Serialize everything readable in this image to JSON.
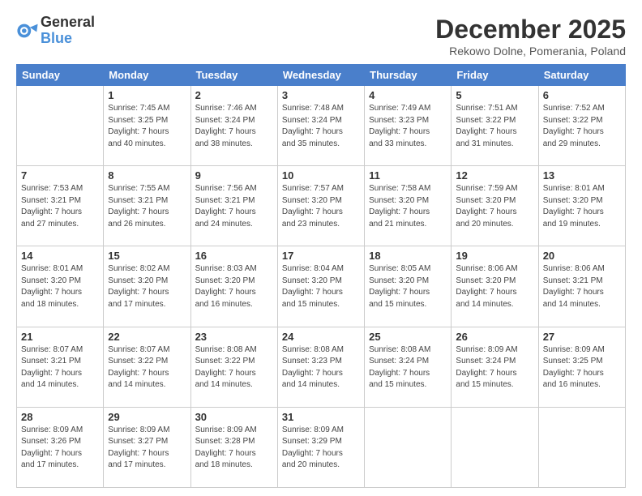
{
  "logo": {
    "general": "General",
    "blue": "Blue"
  },
  "header": {
    "month": "December 2025",
    "location": "Rekowo Dolne, Pomerania, Poland"
  },
  "weekdays": [
    "Sunday",
    "Monday",
    "Tuesday",
    "Wednesday",
    "Thursday",
    "Friday",
    "Saturday"
  ],
  "weeks": [
    [
      {
        "day": "",
        "info": ""
      },
      {
        "day": "1",
        "info": "Sunrise: 7:45 AM\nSunset: 3:25 PM\nDaylight: 7 hours\nand 40 minutes."
      },
      {
        "day": "2",
        "info": "Sunrise: 7:46 AM\nSunset: 3:24 PM\nDaylight: 7 hours\nand 38 minutes."
      },
      {
        "day": "3",
        "info": "Sunrise: 7:48 AM\nSunset: 3:24 PM\nDaylight: 7 hours\nand 35 minutes."
      },
      {
        "day": "4",
        "info": "Sunrise: 7:49 AM\nSunset: 3:23 PM\nDaylight: 7 hours\nand 33 minutes."
      },
      {
        "day": "5",
        "info": "Sunrise: 7:51 AM\nSunset: 3:22 PM\nDaylight: 7 hours\nand 31 minutes."
      },
      {
        "day": "6",
        "info": "Sunrise: 7:52 AM\nSunset: 3:22 PM\nDaylight: 7 hours\nand 29 minutes."
      }
    ],
    [
      {
        "day": "7",
        "info": "Sunrise: 7:53 AM\nSunset: 3:21 PM\nDaylight: 7 hours\nand 27 minutes."
      },
      {
        "day": "8",
        "info": "Sunrise: 7:55 AM\nSunset: 3:21 PM\nDaylight: 7 hours\nand 26 minutes."
      },
      {
        "day": "9",
        "info": "Sunrise: 7:56 AM\nSunset: 3:21 PM\nDaylight: 7 hours\nand 24 minutes."
      },
      {
        "day": "10",
        "info": "Sunrise: 7:57 AM\nSunset: 3:20 PM\nDaylight: 7 hours\nand 23 minutes."
      },
      {
        "day": "11",
        "info": "Sunrise: 7:58 AM\nSunset: 3:20 PM\nDaylight: 7 hours\nand 21 minutes."
      },
      {
        "day": "12",
        "info": "Sunrise: 7:59 AM\nSunset: 3:20 PM\nDaylight: 7 hours\nand 20 minutes."
      },
      {
        "day": "13",
        "info": "Sunrise: 8:01 AM\nSunset: 3:20 PM\nDaylight: 7 hours\nand 19 minutes."
      }
    ],
    [
      {
        "day": "14",
        "info": "Sunrise: 8:01 AM\nSunset: 3:20 PM\nDaylight: 7 hours\nand 18 minutes."
      },
      {
        "day": "15",
        "info": "Sunrise: 8:02 AM\nSunset: 3:20 PM\nDaylight: 7 hours\nand 17 minutes."
      },
      {
        "day": "16",
        "info": "Sunrise: 8:03 AM\nSunset: 3:20 PM\nDaylight: 7 hours\nand 16 minutes."
      },
      {
        "day": "17",
        "info": "Sunrise: 8:04 AM\nSunset: 3:20 PM\nDaylight: 7 hours\nand 15 minutes."
      },
      {
        "day": "18",
        "info": "Sunrise: 8:05 AM\nSunset: 3:20 PM\nDaylight: 7 hours\nand 15 minutes."
      },
      {
        "day": "19",
        "info": "Sunrise: 8:06 AM\nSunset: 3:20 PM\nDaylight: 7 hours\nand 14 minutes."
      },
      {
        "day": "20",
        "info": "Sunrise: 8:06 AM\nSunset: 3:21 PM\nDaylight: 7 hours\nand 14 minutes."
      }
    ],
    [
      {
        "day": "21",
        "info": "Sunrise: 8:07 AM\nSunset: 3:21 PM\nDaylight: 7 hours\nand 14 minutes."
      },
      {
        "day": "22",
        "info": "Sunrise: 8:07 AM\nSunset: 3:22 PM\nDaylight: 7 hours\nand 14 minutes."
      },
      {
        "day": "23",
        "info": "Sunrise: 8:08 AM\nSunset: 3:22 PM\nDaylight: 7 hours\nand 14 minutes."
      },
      {
        "day": "24",
        "info": "Sunrise: 8:08 AM\nSunset: 3:23 PM\nDaylight: 7 hours\nand 14 minutes."
      },
      {
        "day": "25",
        "info": "Sunrise: 8:08 AM\nSunset: 3:24 PM\nDaylight: 7 hours\nand 15 minutes."
      },
      {
        "day": "26",
        "info": "Sunrise: 8:09 AM\nSunset: 3:24 PM\nDaylight: 7 hours\nand 15 minutes."
      },
      {
        "day": "27",
        "info": "Sunrise: 8:09 AM\nSunset: 3:25 PM\nDaylight: 7 hours\nand 16 minutes."
      }
    ],
    [
      {
        "day": "28",
        "info": "Sunrise: 8:09 AM\nSunset: 3:26 PM\nDaylight: 7 hours\nand 17 minutes."
      },
      {
        "day": "29",
        "info": "Sunrise: 8:09 AM\nSunset: 3:27 PM\nDaylight: 7 hours\nand 17 minutes."
      },
      {
        "day": "30",
        "info": "Sunrise: 8:09 AM\nSunset: 3:28 PM\nDaylight: 7 hours\nand 18 minutes."
      },
      {
        "day": "31",
        "info": "Sunrise: 8:09 AM\nSunset: 3:29 PM\nDaylight: 7 hours\nand 20 minutes."
      },
      {
        "day": "",
        "info": ""
      },
      {
        "day": "",
        "info": ""
      },
      {
        "day": "",
        "info": ""
      }
    ]
  ]
}
